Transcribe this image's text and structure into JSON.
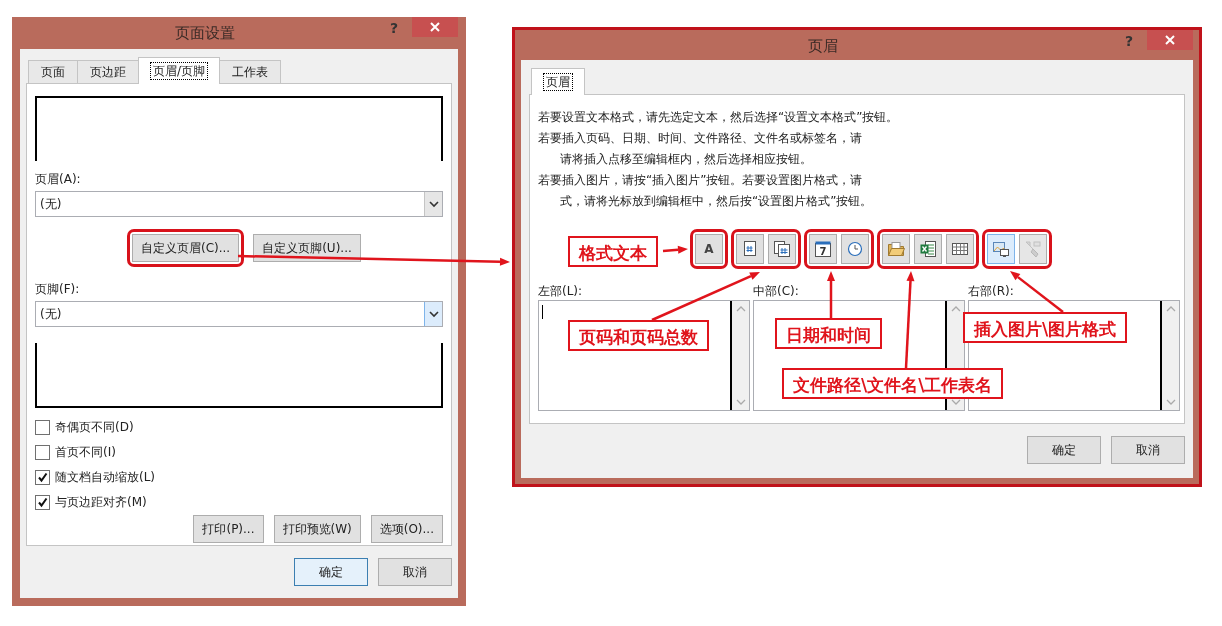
{
  "left_dialog": {
    "title": "页面设置",
    "help": "?",
    "tabs": [
      {
        "label": "页面",
        "selected": false
      },
      {
        "label": "页边距",
        "selected": false
      },
      {
        "label": "页眉/页脚",
        "selected": true
      },
      {
        "label": "工作表",
        "selected": false
      }
    ],
    "header_label": "页眉(A):",
    "header_select": {
      "value": "(无)",
      "focused": false
    },
    "custom_buttons": [
      {
        "label": "自定义页眉(C)...",
        "circled": true
      },
      {
        "label": "自定义页脚(U)...",
        "circled": false
      }
    ],
    "footer_label": "页脚(F):",
    "footer_select": {
      "value": "(无)",
      "focused": true
    },
    "checkboxes": [
      {
        "label": "奇偶页不同(D)",
        "checked": false
      },
      {
        "label": "首页不同(I)",
        "checked": false
      },
      {
        "label": "随文档自动缩放(L)",
        "checked": true
      },
      {
        "label": "与页边距对齐(M)",
        "checked": true
      }
    ],
    "action_buttons": [
      "打印(P)...",
      "打印预览(W)",
      "选项(O)..."
    ],
    "buttons": [
      {
        "label": "确定",
        "default": true
      },
      {
        "label": "取消",
        "default": false
      }
    ]
  },
  "right_dialog": {
    "title": "页眉",
    "help": "?",
    "tabs": [
      {
        "label": "页眉",
        "selected": true
      }
    ],
    "instructions": [
      {
        "text": "若要设置文本格式，请先选定文本，然后选择“设置文本格式”按钮。",
        "indented": false
      },
      {
        "text": "若要插入页码、日期、时间、文件路径、文件名或标签名，请",
        "indented": false
      },
      {
        "text": "请将插入点移至编辑框内，然后选择相应按钮。",
        "indented": true
      },
      {
        "text": "若要插入图片，请按“插入图片”按钮。若要设置图片格式，请",
        "indented": false
      },
      {
        "text": "式，请将光标放到编辑框中，然后按“设置图片格式”按钮。",
        "indented": true
      }
    ],
    "toolbar_groups": [
      {
        "circled": true,
        "buttons": [
          {
            "kind": "format",
            "glyph": "A",
            "highlighted": false,
            "disabled": false
          }
        ]
      },
      {
        "circled": true,
        "buttons": [
          {
            "kind": "page-number",
            "highlighted": false,
            "disabled": false
          },
          {
            "kind": "page-count",
            "highlighted": false,
            "disabled": false
          }
        ]
      },
      {
        "circled": true,
        "buttons": [
          {
            "kind": "date",
            "glyph": "7",
            "highlighted": false,
            "disabled": false
          },
          {
            "kind": "time",
            "highlighted": false,
            "disabled": false
          }
        ]
      },
      {
        "circled": true,
        "buttons": [
          {
            "kind": "file-path",
            "highlighted": false,
            "disabled": false
          },
          {
            "kind": "file-name",
            "highlighted": false,
            "disabled": false
          },
          {
            "kind": "sheet-name",
            "highlighted": false,
            "disabled": false
          }
        ]
      },
      {
        "circled": true,
        "buttons": [
          {
            "kind": "insert-picture",
            "highlighted": true,
            "disabled": false
          },
          {
            "kind": "format-picture",
            "highlighted": false,
            "disabled": true
          }
        ]
      }
    ],
    "sections": [
      {
        "label": "左部(L):",
        "cursor": true
      },
      {
        "label": "中部(C):",
        "cursor": false
      },
      {
        "label": "右部(R):",
        "cursor": false
      }
    ],
    "buttons": [
      {
        "label": "确定",
        "default": false
      },
      {
        "label": "取消",
        "default": false
      }
    ]
  },
  "annotations": [
    {
      "text": "格式文本"
    },
    {
      "text": "页码和页码总数"
    },
    {
      "text": "日期和时间"
    },
    {
      "text": "文件路径\\文件名\\工作表名"
    },
    {
      "text": "插入图片\\图片格式"
    }
  ]
}
